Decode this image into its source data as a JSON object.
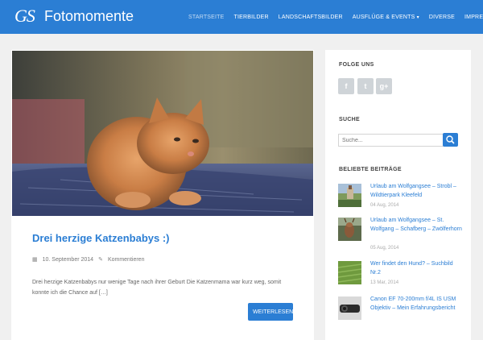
{
  "header": {
    "logo_mark": "GS",
    "site_title": "Fotomomente",
    "nav": [
      {
        "label": "Startseite",
        "active": true
      },
      {
        "label": "Tierbilder"
      },
      {
        "label": "Landschaftsbilder"
      },
      {
        "label": "Ausflüge & Events",
        "caret": "▾"
      },
      {
        "label": "Diverse"
      },
      {
        "label": "Impressum"
      }
    ]
  },
  "post": {
    "image_icon": "kitten-photo",
    "title": "Drei herzige Katzenbabys :)",
    "date": "10. September 2014",
    "comments": "Kommentieren",
    "excerpt": "Drei herzige Katzenbabys nur wenige Tage nach ihrer Geburt Die Katzenmama war kurz weg, somit konnte ich die Chance auf […]",
    "read_more": "Weiterlesen"
  },
  "sidebar": {
    "follow_title": "Folge uns",
    "social": [
      {
        "icon": "facebook-icon",
        "glyph": "f"
      },
      {
        "icon": "twitter-icon",
        "glyph": "t"
      },
      {
        "icon": "google-plus-icon",
        "glyph": "g+"
      }
    ],
    "search_title": "Suche",
    "search_placeholder": "Suche...",
    "popular_title": "Beliebte Beiträge",
    "popular": [
      {
        "title": "Urlaub am Wolfgangsee – Strobl – Wildtierpark Kleefeld",
        "date": "04 Aug, 2014"
      },
      {
        "title": "Urlaub am Wolfgangsee – St. Wolfgang – Schafberg – Zwölferhorn",
        "date": "05 Aug, 2014"
      },
      {
        "title": "Wer findet den Hund? – Suchbild Nr.2",
        "date": "13 Mar, 2014"
      },
      {
        "title": "Canon EF 70-200mm f/4L IS USM Objektiv – Mein Erfahrungsbericht",
        "date": ""
      }
    ]
  },
  "colors": {
    "accent": "#2b7ed4",
    "background": "#f0f0f0"
  }
}
